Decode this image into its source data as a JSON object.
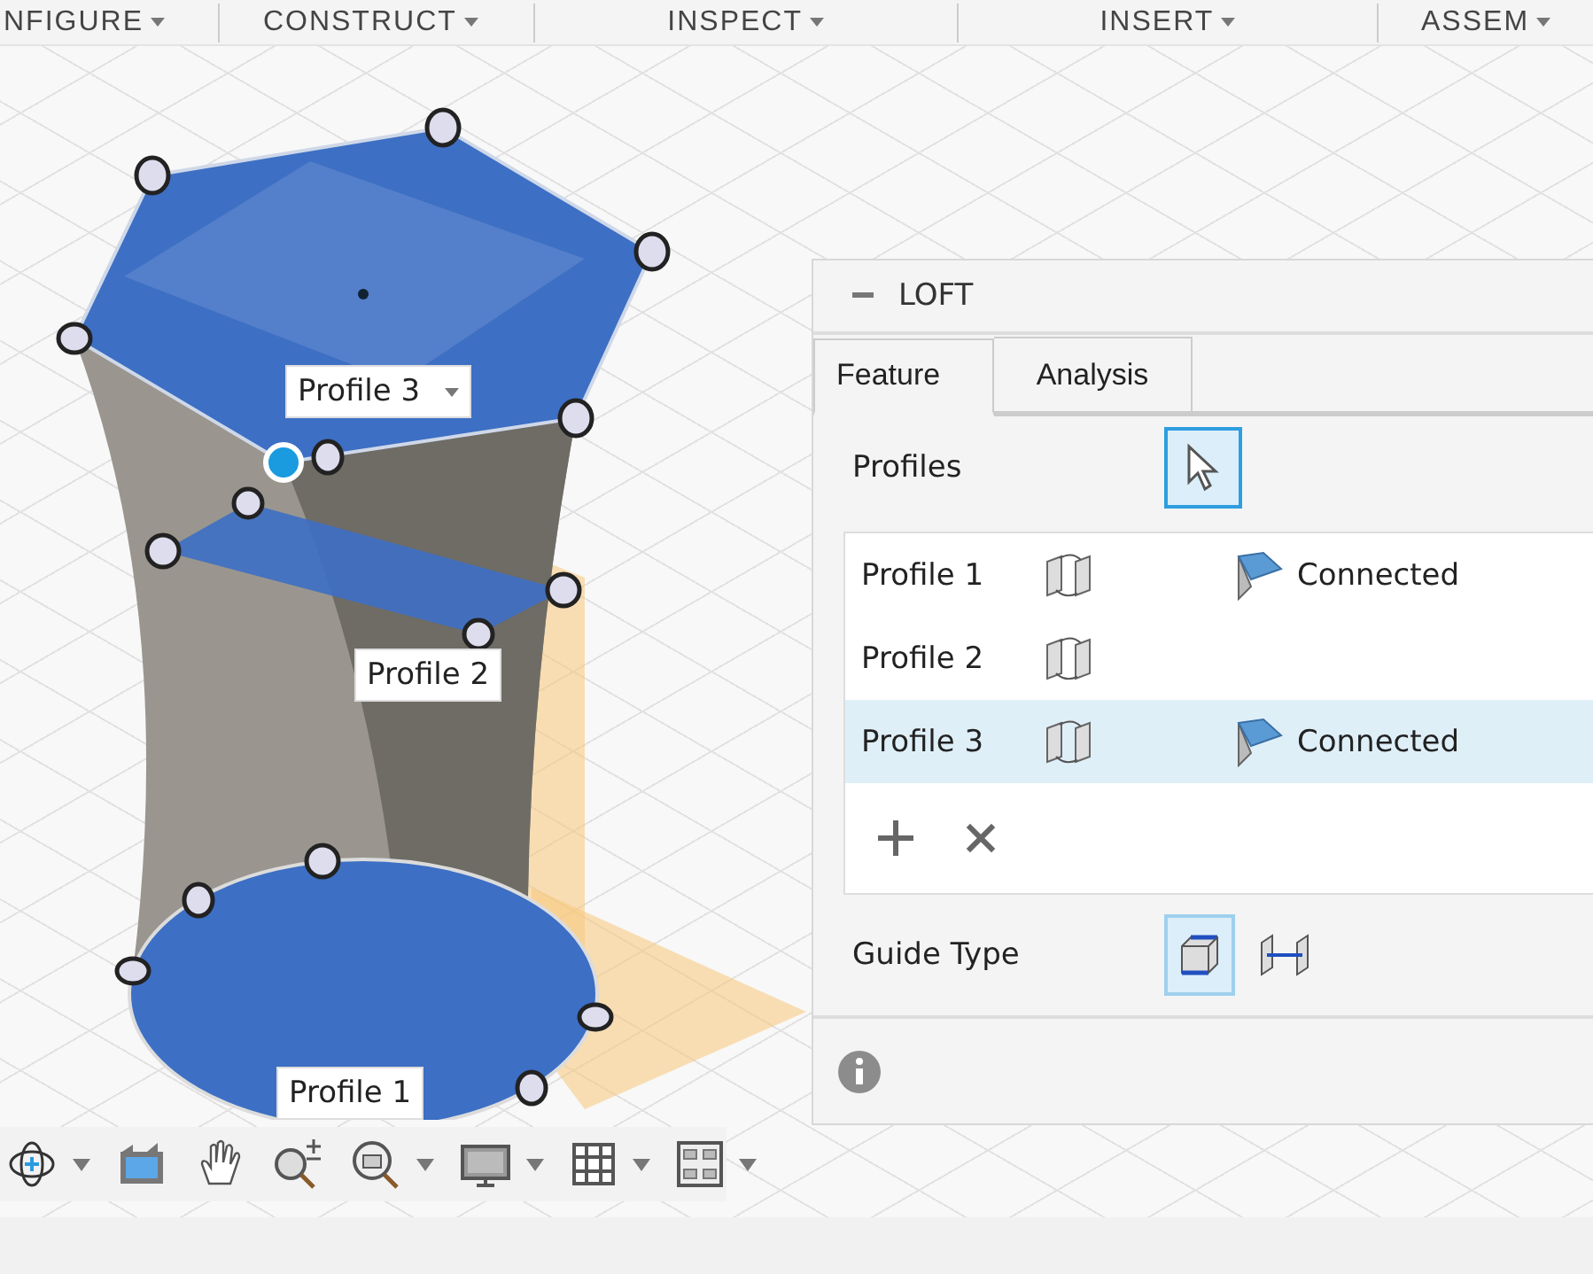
{
  "menu": [
    {
      "label": "NFIGURE"
    },
    {
      "label": "CONSTRUCT"
    },
    {
      "label": "INSPECT"
    },
    {
      "label": "INSERT"
    },
    {
      "label": "ASSEM"
    }
  ],
  "viewport_labels": [
    {
      "text": "Profile 3",
      "dropdown": true
    },
    {
      "text": "Profile 2",
      "dropdown": false
    },
    {
      "text": "Profile 1",
      "dropdown": false
    }
  ],
  "loft": {
    "title": "LOFT",
    "tabs": [
      {
        "label": "Feature",
        "selected": true
      },
      {
        "label": "Analysis",
        "selected": false
      }
    ],
    "profiles_label": "Profiles",
    "select_button": {
      "selected": true
    },
    "profiles": [
      {
        "name": "Profile 1",
        "condition": "Connected",
        "selected": false
      },
      {
        "name": "Profile 2",
        "selected": false
      },
      {
        "name": "Profile 3",
        "condition": "Connected",
        "selected": true
      }
    ],
    "guide_type_label": "Guide Type",
    "guide_types": [
      {
        "kind": "rails",
        "selected": true
      },
      {
        "kind": "centerline",
        "selected": false
      }
    ]
  },
  "nav_toolbar": [
    {
      "kind": "orbit",
      "dropdown": true
    },
    {
      "kind": "look",
      "dropdown": false
    },
    {
      "kind": "pan",
      "dropdown": false
    },
    {
      "kind": "zoom",
      "dropdown": false
    },
    {
      "kind": "fit",
      "dropdown": true
    },
    {
      "kind": "display",
      "dropdown": true
    },
    {
      "kind": "grid",
      "dropdown": true
    },
    {
      "kind": "viewports",
      "dropdown": true
    }
  ]
}
